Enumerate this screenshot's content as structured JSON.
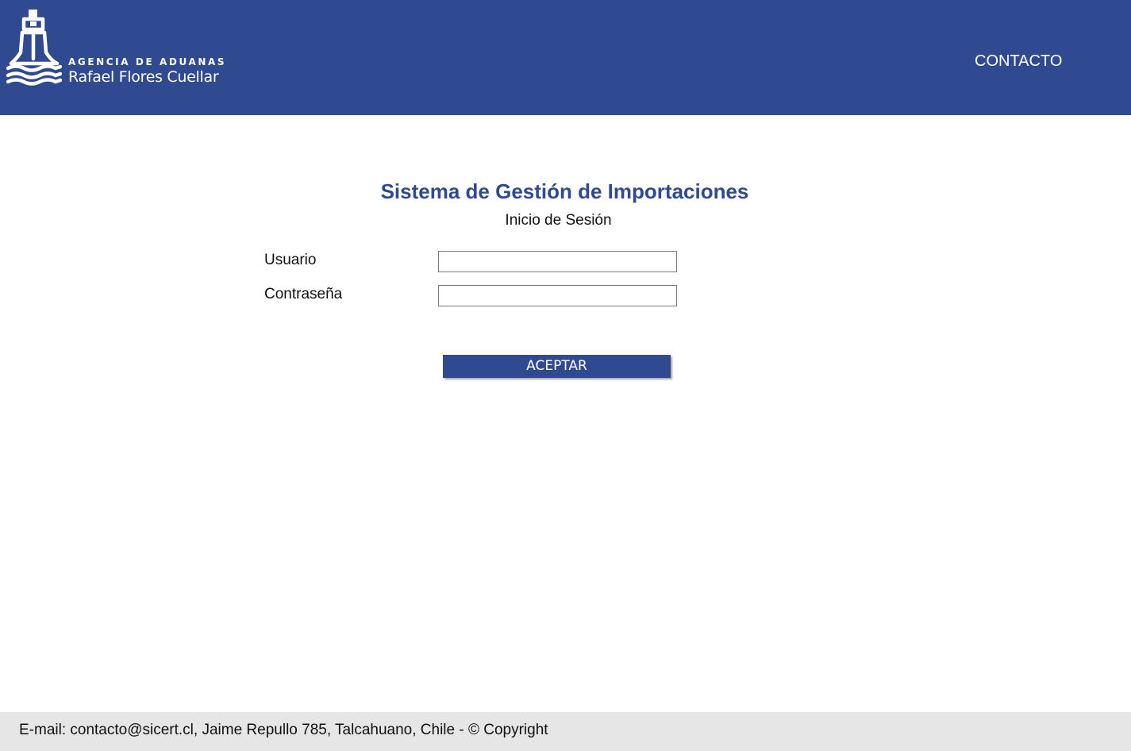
{
  "header": {
    "logo": {
      "line1": "AGENCIA DE ADUANAS",
      "line2": "Rafael Flores Cuellar",
      "icon": "ship-icon"
    },
    "nav": {
      "contact_label": "CONTACTO"
    }
  },
  "main": {
    "title": "Sistema de Gestión de Importaciones",
    "subtitle": "Inicio de Sesión",
    "form": {
      "username_label": "Usuario",
      "username_value": "",
      "password_label": "Contraseña",
      "password_value": "",
      "submit_label": "ACEPTAR"
    }
  },
  "footer": {
    "text": "E-mail: contacto@sicert.cl, Jaime Repullo 785, Talcahuano, Chile - © Copyright"
  },
  "colors": {
    "brand_blue": "#304a91",
    "footer_bg": "#e6e6e6",
    "text": "#111111"
  }
}
